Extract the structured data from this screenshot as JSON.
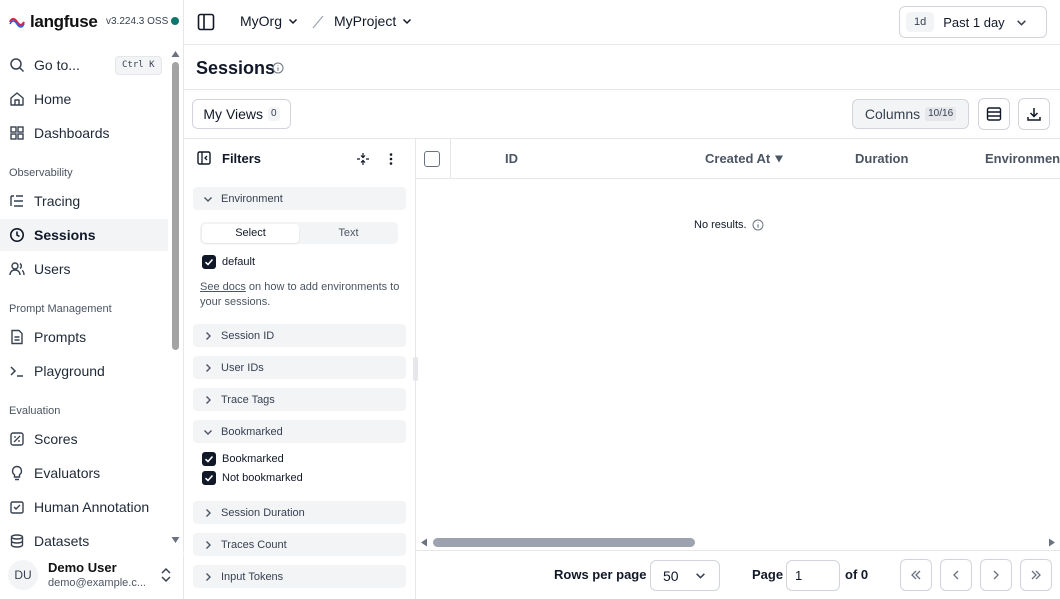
{
  "app": {
    "brand": "langfuse",
    "version": "v3.224.3 OSS"
  },
  "sidebar": {
    "goto": {
      "label": "Go to...",
      "shortcut": "Ctrl K"
    },
    "top_items": [
      {
        "label": "Home",
        "icon": "home-icon"
      },
      {
        "label": "Dashboards",
        "icon": "dashboard-icon"
      }
    ],
    "groups": [
      {
        "label": "Observability",
        "items": [
          {
            "label": "Tracing",
            "icon": "list-tree-icon"
          },
          {
            "label": "Sessions",
            "icon": "clock-icon",
            "active": true
          },
          {
            "label": "Users",
            "icon": "users-icon"
          }
        ]
      },
      {
        "label": "Prompt Management",
        "items": [
          {
            "label": "Prompts",
            "icon": "file-text-icon"
          },
          {
            "label": "Playground",
            "icon": "terminal-icon"
          }
        ]
      },
      {
        "label": "Evaluation",
        "items": [
          {
            "label": "Scores",
            "icon": "score-icon"
          },
          {
            "label": "Evaluators",
            "icon": "lightbulb-icon"
          },
          {
            "label": "Human Annotation",
            "icon": "annotation-icon"
          },
          {
            "label": "Datasets",
            "icon": "database-icon"
          }
        ]
      }
    ],
    "user": {
      "initials": "DU",
      "name": "Demo User",
      "email": "demo@example.c..."
    }
  },
  "header": {
    "org": "MyOrg",
    "project": "MyProject",
    "date_range": {
      "chip": "1d",
      "label": "Past 1 day"
    }
  },
  "page": {
    "title": "Sessions",
    "views_label": "My Views",
    "views_count": "0",
    "columns_label": "Columns",
    "columns_count": "10/16"
  },
  "filters": {
    "title": "Filters",
    "environment": {
      "label": "Environment",
      "mode_select": "Select",
      "mode_text": "Text",
      "option": "default",
      "hint_link": "See docs",
      "hint_rest": " on how to add environments to your sessions."
    },
    "facets": {
      "session_id": "Session ID",
      "user_ids": "User IDs",
      "trace_tags": "Trace Tags",
      "bookmarked": "Bookmarked",
      "session_duration": "Session Duration",
      "traces_count": "Traces Count",
      "input_tokens": "Input Tokens"
    },
    "bookmarked_options": [
      "Bookmarked",
      "Not bookmarked"
    ]
  },
  "table": {
    "columns": [
      "ID",
      "Created At",
      "Duration",
      "Environment"
    ],
    "empty_text": "No results."
  },
  "pagination": {
    "rows_per_page_label": "Rows per page",
    "rows_per_page": "50",
    "page_label": "Page",
    "page_value": "1",
    "of_label": "of 0"
  }
}
